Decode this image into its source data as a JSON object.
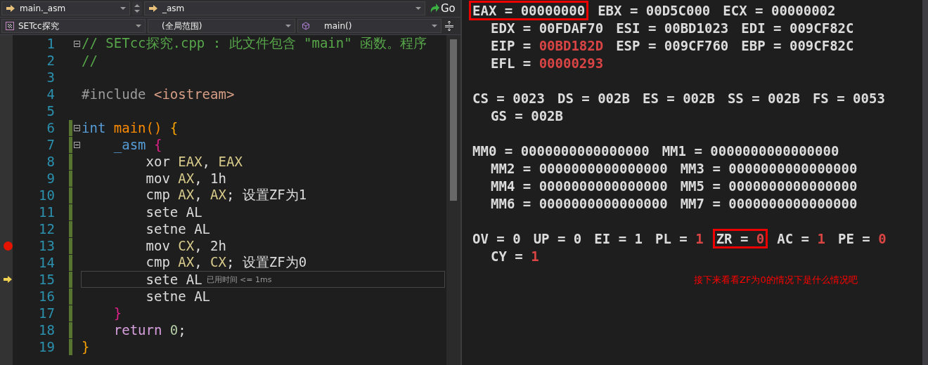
{
  "navigation_bar": {
    "member_dropdown": "main._asm",
    "scope_dropdown": "_asm",
    "go_button": "Go"
  },
  "context_bar": {
    "project_dropdown": "SETcc探究",
    "scope_dropdown": "(全局范围)",
    "function_dropdown": "main()"
  },
  "code_lines": [
    {
      "number": "1",
      "fold": true,
      "changed": false,
      "breakpoint": false,
      "current": false,
      "tokens": [
        {
          "text": "// SETcc探究.cpp : 此文件包含 \"main\" 函数。程序",
          "kind": "comment"
        }
      ]
    },
    {
      "number": "2",
      "fold": false,
      "changed": false,
      "breakpoint": false,
      "current": false,
      "tokens": [
        {
          "text": "//",
          "kind": "comment"
        }
      ]
    },
    {
      "number": "3",
      "fold": false,
      "changed": false,
      "breakpoint": false,
      "current": false
    },
    {
      "number": "4",
      "fold": false,
      "changed": false,
      "breakpoint": false,
      "current": false,
      "tokens": [
        {
          "text": "#include ",
          "kind": "preprocessor"
        },
        {
          "text": "<iostream>",
          "kind": "string"
        }
      ]
    },
    {
      "number": "5",
      "fold": false,
      "changed": false,
      "breakpoint": false,
      "current": false
    },
    {
      "number": "6",
      "fold": true,
      "changed": true,
      "breakpoint": false,
      "current": false,
      "tokens": [
        {
          "text": "int",
          "kind": "keyword"
        },
        {
          "text": " main()",
          "kind": "function"
        },
        {
          "text": " {",
          "kind": "brace"
        }
      ]
    },
    {
      "number": "7",
      "fold": true,
      "changed": true,
      "breakpoint": false,
      "current": false,
      "tokens": [
        {
          "text": "    _asm",
          "kind": "keyword"
        },
        {
          "text": " {",
          "kind": "asm-brace"
        }
      ]
    },
    {
      "number": "8",
      "fold": false,
      "changed": true,
      "breakpoint": false,
      "current": false,
      "tokens": [
        {
          "text": "        xor ",
          "kind": "plain"
        },
        {
          "text": "EAX",
          "kind": "register"
        },
        {
          "text": ", ",
          "kind": "plain"
        },
        {
          "text": "EAX",
          "kind": "register"
        }
      ]
    },
    {
      "number": "9",
      "fold": false,
      "changed": true,
      "breakpoint": false,
      "current": false,
      "tokens": [
        {
          "text": "        mov ",
          "kind": "plain"
        },
        {
          "text": "AX",
          "kind": "register"
        },
        {
          "text": ", 1h",
          "kind": "plain"
        }
      ]
    },
    {
      "number": "10",
      "fold": false,
      "changed": true,
      "breakpoint": false,
      "current": false,
      "tokens": [
        {
          "text": "        cmp ",
          "kind": "plain"
        },
        {
          "text": "AX",
          "kind": "register"
        },
        {
          "text": ", ",
          "kind": "plain"
        },
        {
          "text": "AX",
          "kind": "register"
        },
        {
          "text": "; 设置ZF为1",
          "kind": "plain"
        }
      ]
    },
    {
      "number": "11",
      "fold": false,
      "changed": true,
      "breakpoint": false,
      "current": false,
      "tokens": [
        {
          "text": "        sete AL",
          "kind": "plain"
        }
      ]
    },
    {
      "number": "12",
      "fold": false,
      "changed": true,
      "breakpoint": false,
      "current": false,
      "tokens": [
        {
          "text": "        setne AL",
          "kind": "plain"
        }
      ]
    },
    {
      "number": "13",
      "fold": false,
      "changed": true,
      "breakpoint": true,
      "current": false,
      "tokens": [
        {
          "text": "        mov ",
          "kind": "plain"
        },
        {
          "text": "CX",
          "kind": "register"
        },
        {
          "text": ", 2h",
          "kind": "plain"
        }
      ]
    },
    {
      "number": "14",
      "fold": false,
      "changed": true,
      "breakpoint": false,
      "current": false,
      "tokens": [
        {
          "text": "        cmp ",
          "kind": "plain"
        },
        {
          "text": "AX",
          "kind": "register"
        },
        {
          "text": ", ",
          "kind": "plain"
        },
        {
          "text": "CX",
          "kind": "register"
        },
        {
          "text": "; 设置ZF为0",
          "kind": "plain"
        }
      ]
    },
    {
      "number": "15",
      "fold": false,
      "changed": true,
      "breakpoint": false,
      "current": true,
      "hint": "已用时间 <= 1ms",
      "tokens": [
        {
          "text": "        sete AL",
          "kind": "plain"
        }
      ]
    },
    {
      "number": "16",
      "fold": false,
      "changed": true,
      "breakpoint": false,
      "current": false,
      "tokens": [
        {
          "text": "        setne AL",
          "kind": "plain"
        }
      ]
    },
    {
      "number": "17",
      "fold": false,
      "changed": true,
      "breakpoint": false,
      "current": false,
      "tokens": [
        {
          "text": "    }",
          "kind": "asm-brace"
        }
      ]
    },
    {
      "number": "18",
      "fold": false,
      "changed": true,
      "breakpoint": false,
      "current": false,
      "tokens": [
        {
          "text": "    return",
          "kind": "control"
        },
        {
          "text": " 0",
          "kind": "number"
        },
        {
          "text": ";",
          "kind": "plain"
        }
      ]
    },
    {
      "number": "19",
      "fold": false,
      "changed": true,
      "breakpoint": false,
      "current": false,
      "tokens": [
        {
          "text": "}",
          "kind": "brace"
        }
      ]
    }
  ],
  "register_groups": [
    {
      "lines": [
        {
          "registers": [
            {
              "name": "EAX",
              "sep": "=",
              "value": "00000000",
              "changed": false,
              "boxed": true
            },
            {
              "name": "EBX",
              "sep": "=",
              "value": "00D5C000",
              "changed": false,
              "boxed": false
            },
            {
              "name": "ECX",
              "sep": "=",
              "value": "00000002",
              "changed": false,
              "boxed": false
            }
          ]
        },
        {
          "registers": [
            {
              "name": "EDX",
              "sep": "=",
              "value": "00FDAF70",
              "changed": false,
              "boxed": false
            },
            {
              "name": "ESI",
              "sep": "=",
              "value": "00BD1023",
              "changed": false,
              "boxed": false
            },
            {
              "name": "EDI",
              "sep": "=",
              "value": "009CF82C",
              "changed": false,
              "boxed": false
            }
          ]
        },
        {
          "registers": [
            {
              "name": "EIP",
              "sep": "=",
              "value": "00BD182D",
              "changed": true,
              "boxed": false
            },
            {
              "name": "ESP",
              "sep": "=",
              "value": "009CF760",
              "changed": false,
              "boxed": false
            },
            {
              "name": "EBP",
              "sep": "=",
              "value": "009CF82C",
              "changed": false,
              "boxed": false
            }
          ]
        },
        {
          "registers": [
            {
              "name": "EFL",
              "sep": "=",
              "value": "00000293",
              "changed": true,
              "boxed": false
            }
          ]
        }
      ]
    },
    {
      "lines": [
        {
          "registers": [
            {
              "name": "CS",
              "sep": "=",
              "value": "0023",
              "changed": false,
              "boxed": false
            },
            {
              "name": "DS",
              "sep": "=",
              "value": "002B",
              "changed": false,
              "boxed": false
            },
            {
              "name": "ES",
              "sep": "=",
              "value": "002B",
              "changed": false,
              "boxed": false
            },
            {
              "name": "SS",
              "sep": "=",
              "value": "002B",
              "changed": false,
              "boxed": false
            },
            {
              "name": "FS",
              "sep": "=",
              "value": "0053",
              "changed": false,
              "boxed": false
            }
          ]
        },
        {
          "registers": [
            {
              "name": "GS",
              "sep": "=",
              "value": "002B",
              "changed": false,
              "boxed": false
            }
          ]
        }
      ]
    },
    {
      "lines": [
        {
          "registers": [
            {
              "name": "MM0",
              "sep": "=",
              "value": "0000000000000000",
              "changed": false,
              "boxed": false
            },
            {
              "name": "MM1",
              "sep": "=",
              "value": "0000000000000000",
              "changed": false,
              "boxed": false
            }
          ]
        },
        {
          "registers": [
            {
              "name": "MM2",
              "sep": "=",
              "value": "0000000000000000",
              "changed": false,
              "boxed": false
            },
            {
              "name": "MM3",
              "sep": "=",
              "value": "0000000000000000",
              "changed": false,
              "boxed": false
            }
          ]
        },
        {
          "registers": [
            {
              "name": "MM4",
              "sep": "=",
              "value": "0000000000000000",
              "changed": false,
              "boxed": false
            },
            {
              "name": "MM5",
              "sep": "=",
              "value": "0000000000000000",
              "changed": false,
              "boxed": false
            }
          ]
        },
        {
          "registers": [
            {
              "name": "MM6",
              "sep": "=",
              "value": "0000000000000000",
              "changed": false,
              "boxed": false
            },
            {
              "name": "MM7",
              "sep": "=",
              "value": "0000000000000000",
              "changed": false,
              "boxed": false
            }
          ]
        }
      ]
    },
    {
      "lines": [
        {
          "registers": [
            {
              "name": "OV",
              "sep": "=",
              "value": "0",
              "changed": false,
              "boxed": false
            },
            {
              "name": "UP",
              "sep": "=",
              "value": "0",
              "changed": false,
              "boxed": false
            },
            {
              "name": "EI",
              "sep": "=",
              "value": "1",
              "changed": false,
              "boxed": false
            },
            {
              "name": "PL",
              "sep": "=",
              "value": "1",
              "changed": true,
              "boxed": false
            },
            {
              "name": "ZR",
              "sep": "=",
              "value": "0",
              "changed": true,
              "boxed": true
            },
            {
              "name": "AC",
              "sep": "=",
              "value": "1",
              "changed": true,
              "boxed": false
            },
            {
              "name": "PE",
              "sep": "=",
              "value": "0",
              "changed": true,
              "boxed": false
            }
          ]
        },
        {
          "registers": [
            {
              "name": "CY",
              "sep": "=",
              "value": "1",
              "changed": true,
              "boxed": false
            }
          ]
        }
      ]
    }
  ],
  "annotation": "接下来看看ZF为0的情况下是什么情况吧"
}
